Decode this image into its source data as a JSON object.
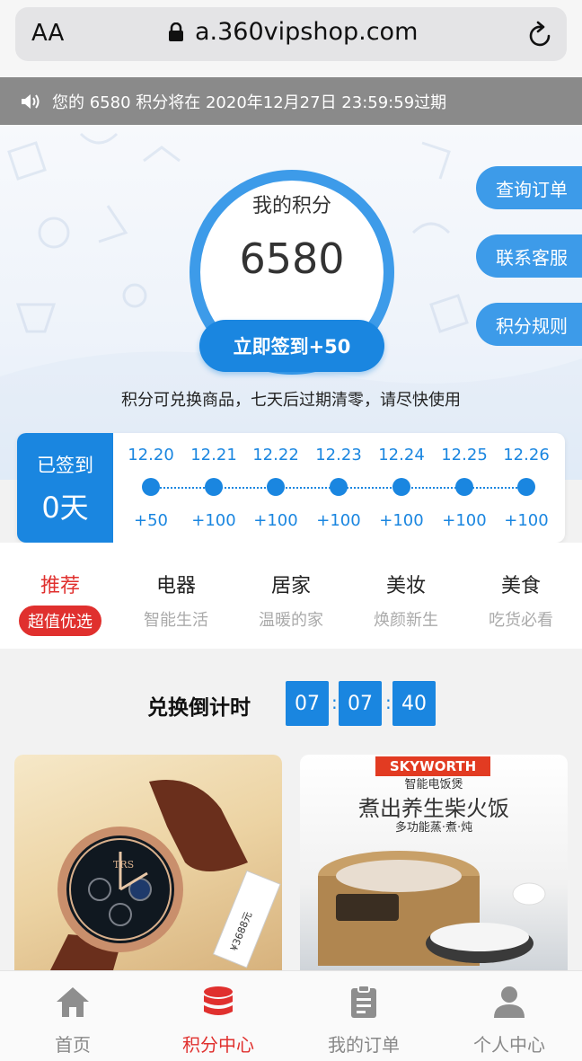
{
  "browser": {
    "text_size_label": "AA",
    "url": "a.360vipshop.com"
  },
  "notice": {
    "text": "您的 6580 积分将在 2020年12月27日 23:59:59过期"
  },
  "points": {
    "label": "我的积分",
    "value": "6580",
    "checkin_button": "立即签到+50",
    "tip": "积分可兑换商品，七天后过期清零，请尽快使用"
  },
  "side_buttons": [
    {
      "label": "查询订单"
    },
    {
      "label": "联系客服"
    },
    {
      "label": "积分规则"
    }
  ],
  "signin": {
    "status_label": "已签到",
    "days": "0天",
    "schedule": [
      {
        "date": "12.20",
        "points": "+50"
      },
      {
        "date": "12.21",
        "points": "+100"
      },
      {
        "date": "12.22",
        "points": "+100"
      },
      {
        "date": "12.23",
        "points": "+100"
      },
      {
        "date": "12.24",
        "points": "+100"
      },
      {
        "date": "12.25",
        "points": "+100"
      },
      {
        "date": "12.26",
        "points": "+100"
      }
    ]
  },
  "categories": [
    {
      "title": "推荐",
      "subtitle": "超值优选",
      "active": true
    },
    {
      "title": "电器",
      "subtitle": "智能生活"
    },
    {
      "title": "居家",
      "subtitle": "温暖的家"
    },
    {
      "title": "美妆",
      "subtitle": "焕颜新生"
    },
    {
      "title": "美食",
      "subtitle": "吃货必看"
    }
  ],
  "countdown": {
    "title": "兑换倒计时",
    "hours": "07",
    "minutes": "07",
    "seconds": "40",
    "separator": ":"
  },
  "products": [
    {
      "watch_brand": "TRS",
      "tag_price": "¥3688元"
    },
    {
      "brand": "SKYWORTH",
      "subtitle": "智能电饭煲",
      "title": "煮出养生柴火饭",
      "features": "多功能蒸·煮·炖"
    }
  ],
  "bottom_nav": [
    {
      "label": "首页",
      "icon": "home-icon"
    },
    {
      "label": "积分中心",
      "icon": "coins-icon",
      "active": true
    },
    {
      "label": "我的订单",
      "icon": "clipboard-icon"
    },
    {
      "label": "个人中心",
      "icon": "user-icon"
    }
  ],
  "colors": {
    "primary_blue": "#1a86e0",
    "accent_red": "#e0302e",
    "notice_gray": "#8a8a8a"
  }
}
